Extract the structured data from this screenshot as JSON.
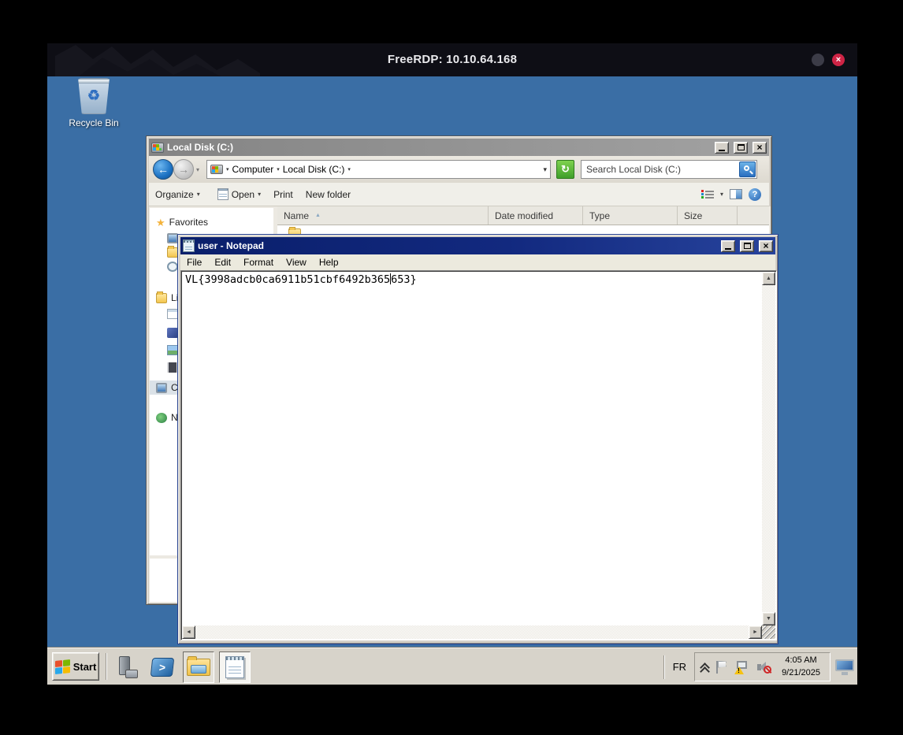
{
  "freerdp": {
    "title": "FreeRDP: 10.10.64.168"
  },
  "desktop": {
    "recycle_bin_label": "Recycle Bin"
  },
  "explorer": {
    "title": "Local Disk (C:)",
    "breadcrumb": {
      "computer": "Computer",
      "current": "Local Disk (C:)"
    },
    "search_placeholder": "Search Local Disk (C:)",
    "toolbar": {
      "organize": "Organize",
      "open": "Open",
      "print": "Print",
      "new_folder": "New folder"
    },
    "columns": {
      "name": "Name",
      "date_modified": "Date modified",
      "type": "Type",
      "size": "Size"
    },
    "sidebar": {
      "favorites": "Favorites",
      "desktop": "Desktop",
      "downloads": "Downloads",
      "recent_places": "Recent Places",
      "libraries": "Libraries",
      "documents": "Documents",
      "music": "Music",
      "pictures": "Pictures",
      "videos": "Videos",
      "computer": "Computer",
      "network": "Network"
    }
  },
  "notepad": {
    "title": "user - Notepad",
    "menu": {
      "file": "File",
      "edit": "Edit",
      "format": "Format",
      "view": "View",
      "help": "Help"
    },
    "text_before_caret": "VL{3998adcb0ca6911b51cbf6492b365",
    "text_after_caret": "653}"
  },
  "taskbar": {
    "start": "Start",
    "language": "FR",
    "time": "4:05 AM",
    "date": "9/21/2025"
  },
  "colors": {
    "desktop_bg": "#3a6ea5",
    "active_title": "#0a1f6b",
    "close_red": "#ce2445",
    "refresh_green": "#3f9f2a",
    "search_blue": "#2a6fc0"
  },
  "icons": {
    "close_glyph": "×",
    "dropdown": "▾",
    "breadcrumb_sep": "▾",
    "back_arrow": "←",
    "forward_arrow": "→",
    "sort_asc": "▲",
    "scroll_up": "▲",
    "scroll_down": "▼",
    "scroll_left": "◄",
    "scroll_right": "►",
    "help": "?",
    "refresh": "↻",
    "recycle": "♻"
  }
}
